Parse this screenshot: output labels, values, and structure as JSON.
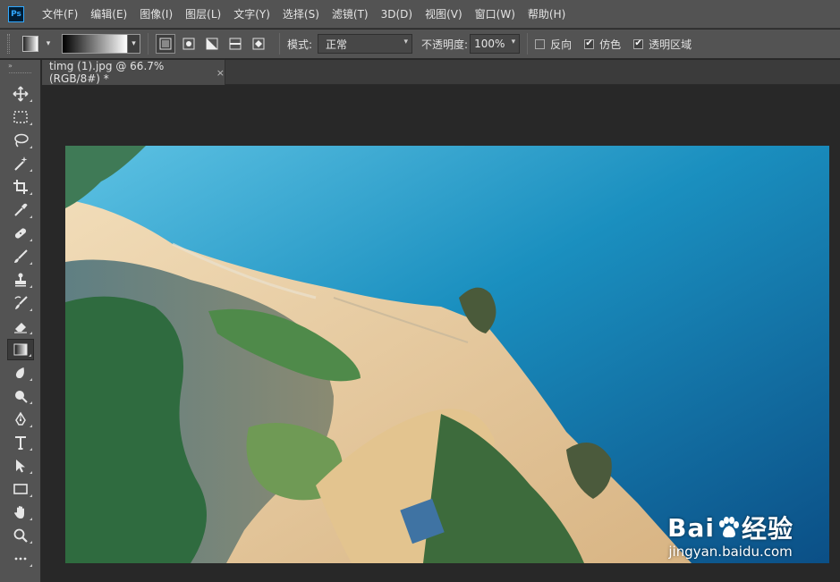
{
  "app": {
    "logo_text": "Ps"
  },
  "menu": [
    "文件(F)",
    "编辑(E)",
    "图像(I)",
    "图层(L)",
    "文字(Y)",
    "选择(S)",
    "滤镜(T)",
    "3D(D)",
    "视图(V)",
    "窗口(W)",
    "帮助(H)"
  ],
  "options": {
    "mode_label": "模式:",
    "mode_value": "正常",
    "opacity_label": "不透明度:",
    "opacity_value": "100%",
    "reverse_label": "反向",
    "reverse_checked": false,
    "dither_label": "仿色",
    "dither_checked": true,
    "transparency_label": "透明区域",
    "transparency_checked": true,
    "check_mark": "✔"
  },
  "document": {
    "tab_title": "timg (1).jpg @ 66.7%(RGB/8#) *",
    "close_glyph": "×"
  },
  "tools": [
    {
      "name": "move-tool",
      "icon": "move-icon"
    },
    {
      "name": "marquee-tool",
      "icon": "rect-marquee-icon"
    },
    {
      "name": "lasso-tool",
      "icon": "lasso-icon"
    },
    {
      "name": "magic-wand-tool",
      "icon": "magic-wand-icon"
    },
    {
      "name": "crop-tool",
      "icon": "crop-icon"
    },
    {
      "name": "eyedropper-tool",
      "icon": "eyedropper-icon"
    },
    {
      "name": "healing-tool",
      "icon": "bandage-icon"
    },
    {
      "name": "brush-tool",
      "icon": "brush-icon"
    },
    {
      "name": "stamp-tool",
      "icon": "stamp-icon"
    },
    {
      "name": "history-brush-tool",
      "icon": "history-brush-icon"
    },
    {
      "name": "eraser-tool",
      "icon": "eraser-icon"
    },
    {
      "name": "gradient-tool",
      "icon": "gradient-icon",
      "active": true
    },
    {
      "name": "blur-tool",
      "icon": "blur-drop-icon"
    },
    {
      "name": "dodge-tool",
      "icon": "dodge-icon"
    },
    {
      "name": "pen-tool",
      "icon": "pen-icon"
    },
    {
      "name": "type-tool",
      "icon": "type-icon"
    },
    {
      "name": "path-select-tool",
      "icon": "arrow-icon"
    },
    {
      "name": "shape-tool",
      "icon": "rectangle-icon"
    },
    {
      "name": "hand-tool",
      "icon": "hand-icon"
    },
    {
      "name": "zoom-tool",
      "icon": "zoom-icon"
    },
    {
      "name": "more-tools",
      "icon": "ellipsis-icon"
    }
  ],
  "watermark": {
    "brand_left": "Bai",
    "brand_right": "经验",
    "url": "jingyan.baidu.com"
  },
  "colors": {
    "accent": "#31a8ff",
    "panel": "#535353",
    "canvas_bg": "#282828"
  }
}
